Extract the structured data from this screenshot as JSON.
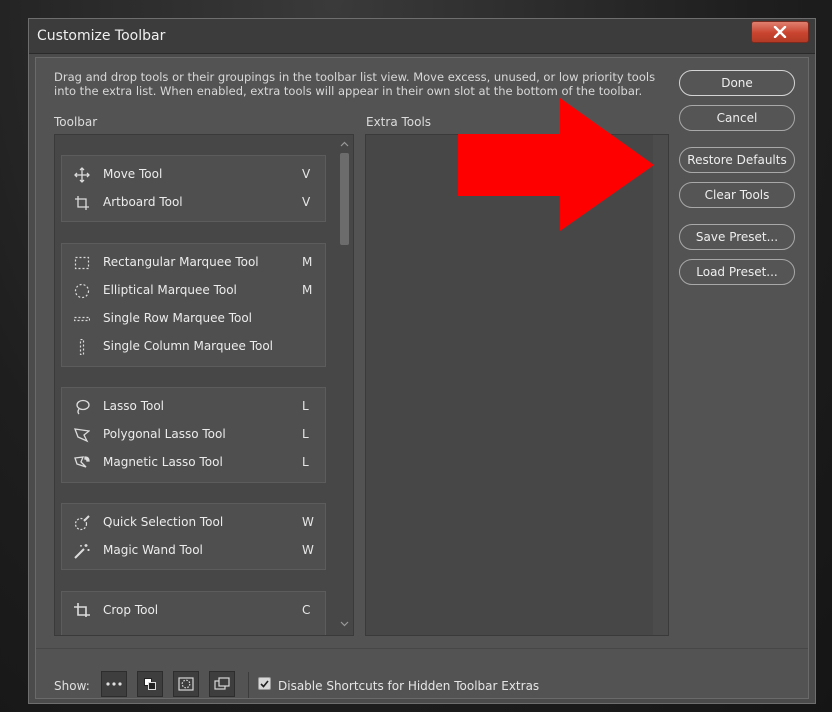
{
  "window": {
    "title": "Customize Toolbar",
    "close_icon": "close-icon"
  },
  "description": "Drag and drop tools or their groupings in the toolbar list view. Move excess, unused, or low priority tools into the extra list. When enabled, extra tools will appear in their own slot at the bottom of the toolbar.",
  "toolbar_label": "Toolbar",
  "extra_label": "Extra Tools",
  "groups": [
    {
      "tools": [
        {
          "name": "Move Tool",
          "key": "V",
          "icon": "move-icon"
        },
        {
          "name": "Artboard Tool",
          "key": "V",
          "icon": "artboard-icon"
        }
      ]
    },
    {
      "tools": [
        {
          "name": "Rectangular Marquee Tool",
          "key": "M",
          "icon": "rect-marquee-icon"
        },
        {
          "name": "Elliptical Marquee Tool",
          "key": "M",
          "icon": "ellipse-marquee-icon"
        },
        {
          "name": "Single Row Marquee Tool",
          "key": "",
          "icon": "row-marquee-icon"
        },
        {
          "name": "Single Column Marquee Tool",
          "key": "",
          "icon": "column-marquee-icon"
        }
      ]
    },
    {
      "tools": [
        {
          "name": "Lasso Tool",
          "key": "L",
          "icon": "lasso-icon"
        },
        {
          "name": "Polygonal Lasso Tool",
          "key": "L",
          "icon": "polygonal-lasso-icon"
        },
        {
          "name": "Magnetic Lasso Tool",
          "key": "L",
          "icon": "magnetic-lasso-icon"
        }
      ]
    },
    {
      "tools": [
        {
          "name": "Quick Selection Tool",
          "key": "W",
          "icon": "quick-selection-icon"
        },
        {
          "name": "Magic Wand Tool",
          "key": "W",
          "icon": "magic-wand-icon"
        }
      ]
    },
    {
      "tools": [
        {
          "name": "Crop Tool",
          "key": "C",
          "icon": "crop-icon"
        }
      ]
    }
  ],
  "buttons": {
    "done": "Done",
    "cancel": "Cancel",
    "restore": "Restore Defaults",
    "clear": "Clear Tools",
    "save": "Save Preset...",
    "load": "Load Preset..."
  },
  "footer": {
    "show_label": "Show:",
    "checkbox_label": "Disable Shortcuts for Hidden Toolbar Extras",
    "checkbox_checked": true
  },
  "annotation": {
    "color": "#ff0000"
  }
}
